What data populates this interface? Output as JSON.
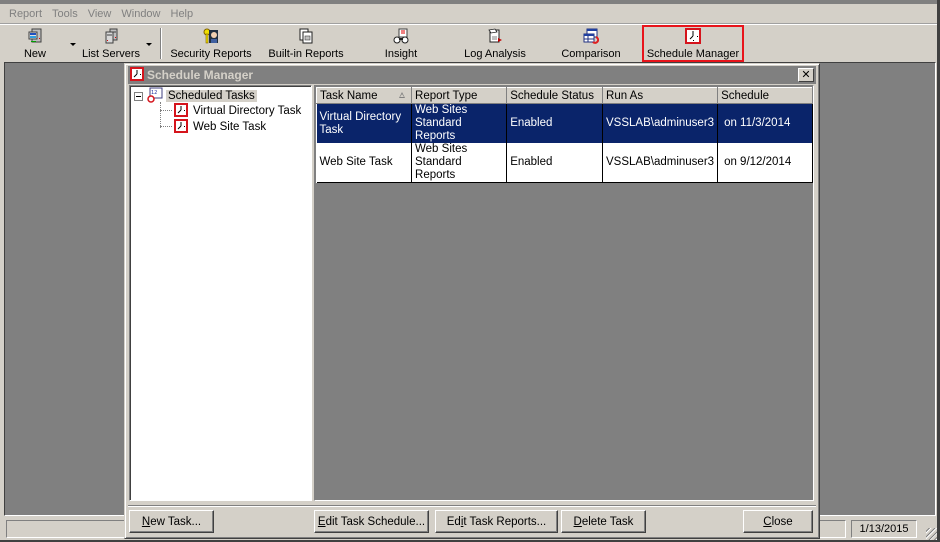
{
  "menubar": {
    "items": [
      "Report",
      "Tools",
      "View",
      "Window",
      "Help"
    ]
  },
  "toolbar": {
    "buttons": [
      {
        "label": "New",
        "icon": "new-server-icon",
        "has_dropdown": true
      },
      {
        "label": "List Servers",
        "icon": "servers-icon",
        "has_dropdown": true
      },
      {
        "label": "Security Reports",
        "icon": "security-key-user-icon"
      },
      {
        "label": "Built-in Reports",
        "icon": "clipboard-reports-icon"
      },
      {
        "label": "Insight",
        "icon": "insight-binoculars-icon"
      },
      {
        "label": "Log Analysis",
        "icon": "log-analysis-icon"
      },
      {
        "label": "Comparison",
        "icon": "comparison-icon"
      },
      {
        "label": "Schedule Manager",
        "icon": "clock-icon",
        "highlighted": true
      }
    ],
    "highlight_color": "#e8141b"
  },
  "dialog": {
    "title": "Schedule Manager",
    "close_glyph": "✕",
    "tree": {
      "root": "Scheduled Tasks",
      "children": [
        "Virtual Directory Task",
        "Web Site Task"
      ]
    },
    "table": {
      "columns": [
        "Task Name",
        "Report Type",
        "Schedule Status",
        "Run As",
        "Schedule"
      ],
      "sorted_column": "Task Name",
      "rows": [
        {
          "task_name": "Virtual Directory Task",
          "report_type": "Web Sites Standard Reports",
          "status": "Enabled",
          "run_as": "VSSLAB\\adminuser3",
          "schedule": "on 11/3/2014",
          "selected": true
        },
        {
          "task_name": "Web Site Task",
          "report_type": "Web Sites Standard Reports",
          "status": "Enabled",
          "run_as": "VSSLAB\\adminuser3",
          "schedule": "on 9/12/2014",
          "selected": false
        }
      ]
    },
    "buttons": {
      "new_task": {
        "mnemonic": "N",
        "rest": "ew Task..."
      },
      "edit_schedule": {
        "mnemonic": "E",
        "rest": "dit Task Schedule..."
      },
      "edit_reports": {
        "pre": "Ed",
        "mnemonic": "i",
        "rest": "t Task Reports..."
      },
      "delete_task": {
        "mnemonic": "D",
        "rest": "elete Task"
      },
      "close": {
        "mnemonic": "C",
        "rest": "lose"
      }
    },
    "selection_color": "#0a246a"
  },
  "statusbar": {
    "text": "",
    "date": "1/13/2015"
  }
}
